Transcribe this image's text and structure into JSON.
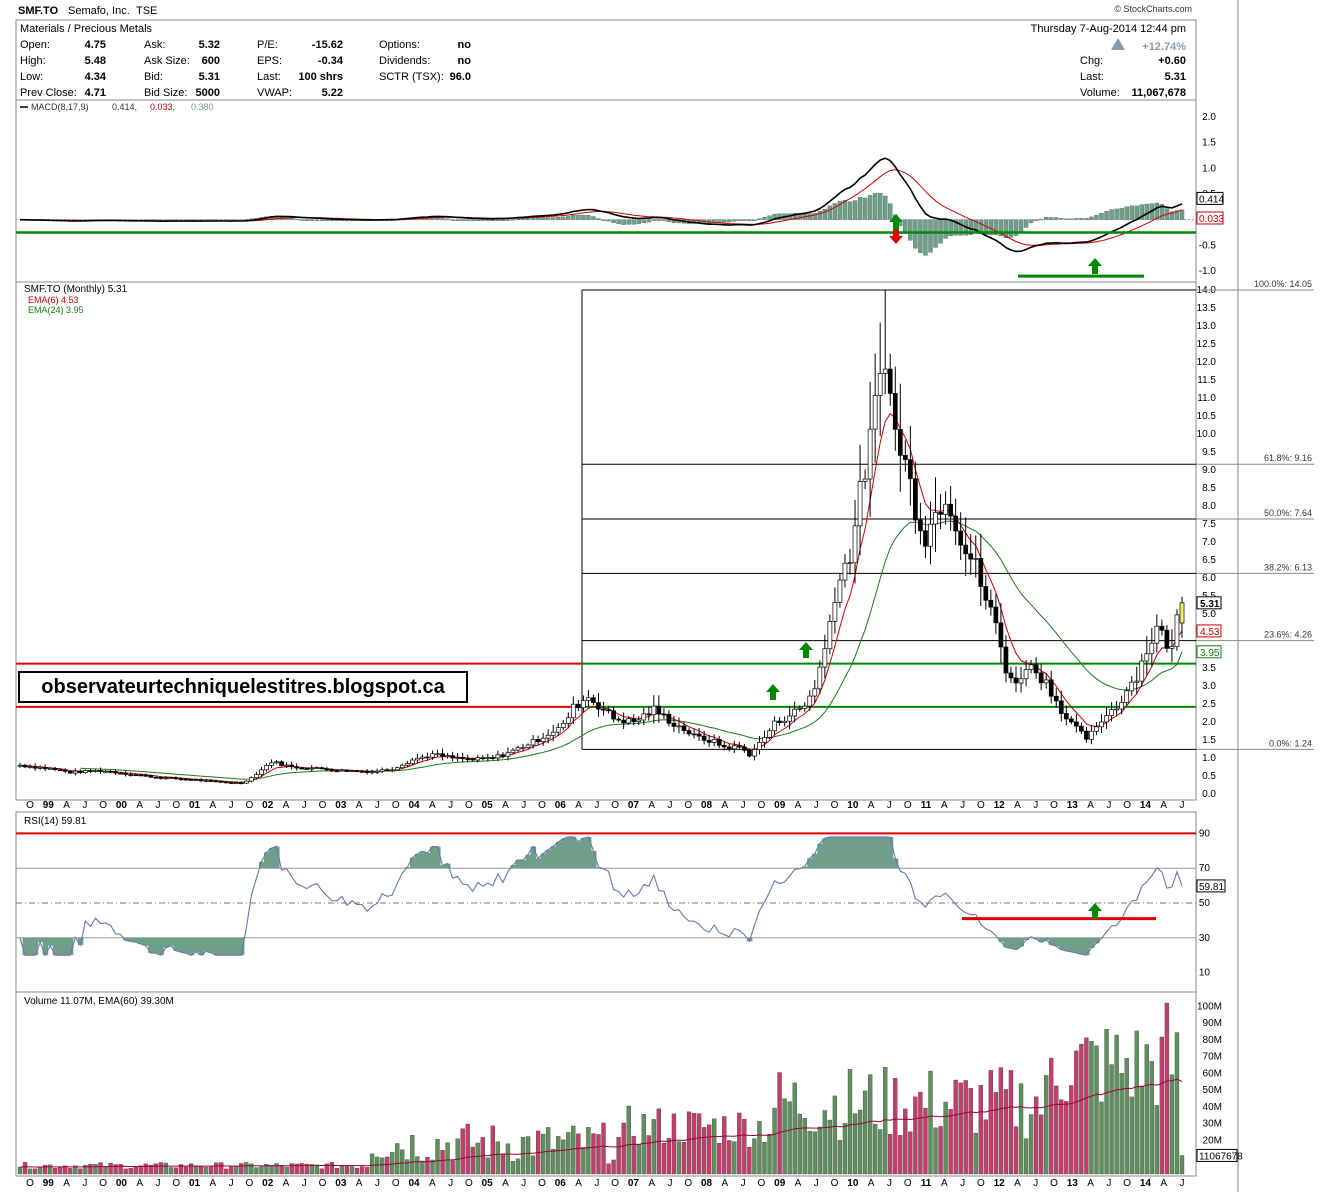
{
  "header": {
    "symbol": "SMF.TO",
    "company": "Semafo, Inc.",
    "exchange": "TSE",
    "sector": "Materials / Precious Metals",
    "watermark": "© StockCharts.com",
    "date": "Thursday  7-Aug-2014  12:44 pm",
    "pct_change": "+12.74%",
    "quote_left": [
      {
        "label": "Open:",
        "value": "4.75"
      },
      {
        "label": "High:",
        "value": "5.48"
      },
      {
        "label": "Low:",
        "value": "4.34"
      },
      {
        "label": "Prev Close:",
        "value": "4.71"
      }
    ],
    "quote_mid": [
      {
        "label": "Ask:",
        "value": "5.32"
      },
      {
        "label": "Ask Size:",
        "value": "600"
      },
      {
        "label": "Bid:",
        "value": "5.31"
      },
      {
        "label": "Bid Size:",
        "value": "5000"
      }
    ],
    "quote_mid2": [
      {
        "label": "P/E:",
        "value": "-15.62"
      },
      {
        "label": "EPS:",
        "value": "-0.34"
      },
      {
        "label": "Last:",
        "value": "100 shrs"
      },
      {
        "label": "VWAP:",
        "value": "5.22"
      }
    ],
    "quote_right": [
      {
        "label": "Options:",
        "value": "no"
      },
      {
        "label": "Dividends:",
        "value": "no"
      },
      {
        "label": "SCTR (TSX):",
        "value": "96.0"
      }
    ],
    "quote_far": [
      {
        "label": "Chg:",
        "value": "+0.60"
      },
      {
        "label": "Last:",
        "value": "5.31"
      },
      {
        "label": "Volume:",
        "value": "11,067,678"
      }
    ]
  },
  "blog_label": "observateurtechniquelestitres.blogspot.ca",
  "colors": {
    "up_candle": "#ffffff",
    "down_candle": "#000000",
    "ema6": "#cc0000",
    "ema24": "#1a7a1a",
    "hist": "#6f9f8a",
    "rsi_line": "#6677aa",
    "vol_up": "#5f8f5f",
    "vol_down": "#c0406a",
    "support_red": "#dd0000",
    "support_green": "#008800",
    "last_candle": "#ffee66"
  },
  "chart_data": [
    {
      "type": "line",
      "panel": "MACD",
      "legend": "MACD(8,17,9) 0.414, 0.033, 0.380",
      "legend_parts": {
        "name": "MACD(8,17,9)",
        "macd": "0.414,",
        "signal": "0.033,",
        "hist": "0.380"
      },
      "ylim": [
        -1.15,
        2.15
      ],
      "yticks": [
        "2.0",
        "1.5",
        "1.0",
        "0.5",
        "0.0",
        "-0.5",
        "-1.0"
      ],
      "tags": [
        "0.414",
        "0.033"
      ],
      "support_level": -0.25
    },
    {
      "type": "candlestick",
      "panel": "Price",
      "legend": "SMF.TO (Monthly) 5.31",
      "legend_ema6": "EMA(6) 4.53",
      "legend_ema24": "EMA(24) 3.95",
      "ylim": [
        0,
        14.0
      ],
      "yticks": [
        "14.0",
        "13.5",
        "13.0",
        "12.5",
        "12.0",
        "11.5",
        "11.0",
        "10.5",
        "10.0",
        "9.5",
        "9.0",
        "8.5",
        "8.0",
        "7.5",
        "7.0",
        "6.5",
        "6.0",
        "5.5",
        "5.0",
        "4.5",
        "4.0",
        "3.5",
        "3.0",
        "2.5",
        "2.0",
        "1.5",
        "1.0",
        "0.5",
        "0.0"
      ],
      "fib_levels": [
        {
          "label": "100.0%: 14.05",
          "value": 14.05
        },
        {
          "label": "61.8%: 9.16",
          "value": 9.16
        },
        {
          "label": "50.0%: 7.64",
          "value": 7.64
        },
        {
          "label": "38.2%: 6.13",
          "value": 6.13
        },
        {
          "label": "23.6%: 4.26",
          "value": 4.26
        },
        {
          "label": "0.0%: 1.24",
          "value": 1.24
        }
      ],
      "support_red": [
        3.62,
        2.42
      ],
      "support_green": [
        3.62,
        2.42
      ],
      "tags": [
        "5.31",
        "4.53",
        "3.95"
      ],
      "x_labels": [
        "O",
        "99",
        "A",
        "J",
        "O",
        "00",
        "A",
        "J",
        "O",
        "01",
        "A",
        "J",
        "O",
        "02",
        "A",
        "J",
        "O",
        "03",
        "A",
        "J",
        "O",
        "04",
        "A",
        "J",
        "O",
        "05",
        "A",
        "J",
        "O",
        "06",
        "A",
        "J",
        "O",
        "07",
        "A",
        "J",
        "O",
        "08",
        "A",
        "J",
        "O",
        "09",
        "A",
        "J",
        "O",
        "10",
        "A",
        "J",
        "O",
        "11",
        "A",
        "J",
        "O",
        "12",
        "A",
        "J",
        "O",
        "13",
        "A",
        "J",
        "O",
        "14",
        "A",
        "J"
      ],
      "anchors": [
        [
          0,
          0.8
        ],
        [
          6,
          0.7
        ],
        [
          10,
          0.6
        ],
        [
          16,
          0.65
        ],
        [
          22,
          0.55
        ],
        [
          28,
          0.45
        ],
        [
          34,
          0.4
        ],
        [
          38,
          0.35
        ],
        [
          44,
          0.3
        ],
        [
          46,
          0.45
        ],
        [
          50,
          0.9
        ],
        [
          54,
          0.75
        ],
        [
          60,
          0.7
        ],
        [
          64,
          0.65
        ],
        [
          70,
          0.62
        ],
        [
          74,
          0.7
        ],
        [
          78,
          0.95
        ],
        [
          82,
          1.1
        ],
        [
          86,
          1.0
        ],
        [
          90,
          0.95
        ],
        [
          94,
          1.0
        ],
        [
          98,
          1.2
        ],
        [
          102,
          1.45
        ],
        [
          104,
          1.6
        ],
        [
          108,
          1.9
        ],
        [
          110,
          2.4
        ],
        [
          113,
          2.7
        ],
        [
          116,
          2.35
        ],
        [
          118,
          2.1
        ],
        [
          122,
          2.0
        ],
        [
          126,
          2.35
        ],
        [
          130,
          1.95
        ],
        [
          132,
          1.8
        ],
        [
          134,
          1.6
        ],
        [
          138,
          1.45
        ],
        [
          140,
          1.3
        ],
        [
          143,
          1.3
        ],
        [
          145,
          1.1
        ],
        [
          147,
          1.4
        ],
        [
          150,
          1.95
        ],
        [
          153,
          2.2
        ],
        [
          156,
          2.45
        ],
        [
          158,
          3.0
        ],
        [
          160,
          4.0
        ],
        [
          162,
          5.6
        ],
        [
          165,
          6.7
        ],
        [
          167,
          8.3
        ],
        [
          169,
          9.8
        ],
        [
          171,
          11.6
        ],
        [
          172,
          12.4
        ],
        [
          173,
          11.0
        ],
        [
          174,
          10.0
        ],
        [
          176,
          9.2
        ],
        [
          178,
          8.0
        ],
        [
          180,
          7.2
        ],
        [
          182,
          7.8
        ],
        [
          184,
          8.4
        ],
        [
          186,
          7.6
        ],
        [
          188,
          6.8
        ],
        [
          190,
          6.3
        ],
        [
          192,
          5.4
        ],
        [
          194,
          4.7
        ],
        [
          196,
          3.5
        ],
        [
          198,
          3.0
        ],
        [
          200,
          3.6
        ],
        [
          202,
          3.4
        ],
        [
          204,
          3.1
        ],
        [
          206,
          2.6
        ],
        [
          208,
          2.1
        ],
        [
          210,
          1.8
        ],
        [
          212,
          1.55
        ],
        [
          214,
          1.8
        ],
        [
          216,
          2.25
        ],
        [
          218,
          2.4
        ],
        [
          220,
          2.9
        ],
        [
          222,
          3.3
        ],
        [
          224,
          4.0
        ],
        [
          226,
          4.6
        ],
        [
          228,
          4.2
        ],
        [
          229,
          4.0
        ],
        [
          230,
          4.9
        ],
        [
          231,
          5.31
        ]
      ],
      "series": [
        {
          "name": "EMA(6)",
          "period": 6
        },
        {
          "name": "EMA(24)",
          "period": 24
        }
      ]
    },
    {
      "type": "line",
      "panel": "RSI",
      "legend": "RSI(14) 59.81",
      "ylim": [
        0,
        100
      ],
      "yticks": [
        "90",
        "70",
        "50",
        "30",
        "10"
      ],
      "overbought": 90,
      "oversold": 30,
      "tag": "59.81",
      "support_level": 41
    },
    {
      "type": "bar",
      "panel": "Volume",
      "legend": "Volume 11.07M, EMA(60) 39.30M",
      "ylim": [
        0,
        105
      ],
      "yticks": [
        "100M",
        "90M",
        "80M",
        "70M",
        "60M",
        "50M",
        "40M",
        "30M",
        "20M",
        "10M"
      ],
      "tag": "11067678",
      "unit": "M"
    }
  ]
}
